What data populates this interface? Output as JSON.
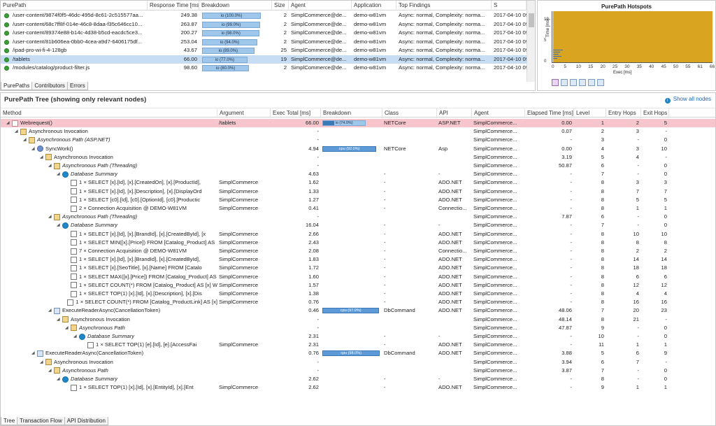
{
  "purepaths": {
    "columns": [
      "PurePath",
      "Response Time [ms]",
      "Breakdown",
      "Size",
      "Agent",
      "Application",
      "Top Findings",
      "S"
    ],
    "rows": [
      {
        "path": "/user-content/9874f0f5-46dc-495d-8c61-2c515577aa...",
        "rt": "249.38",
        "bd": "io (100.0%)",
        "bd_pct": 1.0,
        "size": "2",
        "agent": "SimplCommerce@de...",
        "app": "demo-w81vm",
        "findings": "Async: normal, Complexity: norma...",
        "s": "2017-04-10 09:"
      },
      {
        "path": "/user-content/68c7ff8f-014e-46c8-8daa-f35c646cc10...",
        "rt": "263.87",
        "bd": "io (99.0%)",
        "bd_pct": 0.99,
        "size": "2",
        "agent": "SimplCommerce@de...",
        "app": "demo-w81vm",
        "findings": "Async: normal, Complexity: norma...",
        "s": "2017-04-10 09:"
      },
      {
        "path": "/user-content/89374e88-b14c-4d38-b5cd-eacdc5ce3...",
        "rt": "200.27",
        "bd": "io (98.0%)",
        "bd_pct": 0.98,
        "size": "2",
        "agent": "SimplCommerce@de...",
        "app": "demo-w81vm",
        "findings": "Async: normal, Complexity: norma...",
        "s": "2017-04-10 09:"
      },
      {
        "path": "/user-content/81b606ea-0bb0-4cea-a9d7-6406175df...",
        "rt": "253.04",
        "bd": "io (94.0%)",
        "bd_pct": 0.94,
        "size": "2",
        "agent": "SimplCommerce@de...",
        "app": "demo-w81vm",
        "findings": "Async: normal, Complexity: norma...",
        "s": "2017-04-10 09:"
      },
      {
        "path": "/ipad-pro-wi-fi-4-128gb",
        "rt": "43.67",
        "bd": "io (89.0%)",
        "bd_pct": 0.89,
        "size": "25",
        "agent": "SimplCommerce@de...",
        "app": "demo-w81vm",
        "findings": "Async: normal, Complexity: norma...",
        "s": "2017-04-10 09:"
      },
      {
        "path": "/tablets",
        "rt": "66.00",
        "bd": "io (77.0%)",
        "bd_pct": 0.77,
        "size": "19",
        "agent": "SimplCommerce@de...",
        "app": "demo-w81vm",
        "findings": "Async: normal, Complexity: norma...",
        "s": "2017-04-10 09:"
      },
      {
        "path": "/modules/catalog/product-filter.js",
        "rt": "98.60",
        "bd": "io (80.0%)",
        "bd_pct": 0.8,
        "size": "2",
        "agent": "SimplCommerce@de...",
        "app": "demo-w81vm",
        "findings": "Async: normal, Complexity: norma...",
        "s": "2017-04-10 09:"
      }
    ],
    "tabs": [
      "PurePaths",
      "Contributors",
      "Errors"
    ]
  },
  "hotspots": {
    "title": "PurePath Hotspots",
    "x_label": "Exec [ms]",
    "y_label": "Time [ms]",
    "x_ticks": [
      "0",
      "5",
      "10",
      "15",
      "20",
      "25",
      "30",
      "35",
      "40",
      "45",
      "50",
      "55",
      "61",
      "66"
    ],
    "y_ticks": [
      "19",
      "5",
      "0"
    ]
  },
  "tree": {
    "title": "PurePath Tree (showing only relevant nodes)",
    "show_all": "Show all nodes",
    "columns": [
      "Method",
      "Argument",
      "Exec Total [ms]",
      "Breakdown",
      "Class",
      "API",
      "Agent",
      "Elapsed Time [ms]",
      "Level",
      "Entry Hops",
      "Exit Hops"
    ],
    "rows": [
      {
        "d": 0,
        "icon": "web",
        "method": "Webrequest()",
        "arg": "/tablets",
        "exec": "66.00",
        "bd": "io (74.0%)",
        "bd_pct": 0.74,
        "bd_type": "io",
        "cls": "NETCore",
        "api": "ASP.NET",
        "agent": "SimplCommerce...",
        "el": "0.00",
        "lvl": "1",
        "eh": "2",
        "xh": "5",
        "hl": true
      },
      {
        "d": 1,
        "icon": "async",
        "method": "Asynchronous Invocation",
        "arg": "",
        "exec": "-",
        "bd": "",
        "cls": "",
        "api": "",
        "agent": "SimplCommerce...",
        "el": "0.07",
        "lvl": "2",
        "eh": "3",
        "xh": "-"
      },
      {
        "d": 2,
        "icon": "async",
        "method": "Asynchronous Path (ASP.NET)",
        "it": true,
        "arg": "",
        "exec": "-",
        "bd": "",
        "cls": "",
        "api": "",
        "agent": "SimplCommerce...",
        "el": "-",
        "lvl": "3",
        "eh": "-",
        "xh": "0"
      },
      {
        "d": 3,
        "icon": "sync",
        "method": "SyncWork()",
        "arg": "",
        "exec": "4.94",
        "bd": "cpu (92.0%)",
        "bd_pct": 0.92,
        "bd_type": "cpu",
        "cls": "NETCore",
        "api": "Asp",
        "agent": "SimplCommerce...",
        "el": "0.00",
        "lvl": "4",
        "eh": "3",
        "xh": "10"
      },
      {
        "d": 4,
        "icon": "async",
        "method": "Asynchronous Invocation",
        "arg": "",
        "exec": "-",
        "bd": "",
        "cls": "",
        "api": "",
        "agent": "SimplCommerce...",
        "el": "3.19",
        "lvl": "5",
        "eh": "4",
        "xh": "-"
      },
      {
        "d": 5,
        "icon": "async",
        "method": "Asynchronous Path (Threading)",
        "it": true,
        "arg": "",
        "exec": "-",
        "bd": "",
        "cls": "",
        "api": "",
        "agent": "SimplCommerce...",
        "el": "50.87",
        "lvl": "6",
        "eh": "-",
        "xh": "0"
      },
      {
        "d": 6,
        "icon": "db",
        "method": "Database Summary",
        "it": true,
        "arg": "",
        "exec": "4.63",
        "bd": "",
        "cls": "-",
        "api": "-",
        "agent": "SimplCommerce...",
        "el": "-",
        "lvl": "7",
        "eh": "-",
        "xh": "0"
      },
      {
        "d": 7,
        "icon": "sql",
        "method": "1 × SELECT [x].[Id], [x].[CreatedOn], [x].[ProductId],",
        "arg": "SimplCommerce",
        "exec": "1.62",
        "bd": "",
        "cls": "-",
        "api": "ADO.NET",
        "agent": "SimplCommerce...",
        "el": "-",
        "lvl": "8",
        "eh": "3",
        "xh": "3"
      },
      {
        "d": 7,
        "icon": "sql",
        "method": "1 × SELECT [x].[Id], [x].[Description], [x].[DisplayOrd",
        "arg": "SimplCommerce",
        "exec": "1.33",
        "bd": "",
        "cls": "-",
        "api": "ADO.NET",
        "agent": "SimplCommerce...",
        "el": "-",
        "lvl": "8",
        "eh": "7",
        "xh": "7"
      },
      {
        "d": 7,
        "icon": "sql",
        "method": "1 × SELECT [c0].[Id], [c0].[OptionId], [c0].[Productic",
        "arg": "SimplCommerce",
        "exec": "1.27",
        "bd": "",
        "cls": "-",
        "api": "ADO.NET",
        "agent": "SimplCommerce...",
        "el": "-",
        "lvl": "8",
        "eh": "5",
        "xh": "5"
      },
      {
        "d": 7,
        "icon": "sql",
        "method": "2 × Connection Acquisition @ DEMO-W81VM",
        "arg": "SimplCommerce",
        "exec": "0.41",
        "bd": "",
        "cls": "-",
        "api": "Connectio...",
        "agent": "SimplCommerce...",
        "el": "-",
        "lvl": "8",
        "eh": "1",
        "xh": "1"
      },
      {
        "d": 5,
        "icon": "async",
        "method": "Asynchronous Path (Threading)",
        "it": true,
        "arg": "",
        "exec": "-",
        "bd": "",
        "cls": "",
        "api": "",
        "agent": "SimplCommerce...",
        "el": "7.87",
        "lvl": "6",
        "eh": "-",
        "xh": "0"
      },
      {
        "d": 6,
        "icon": "db",
        "method": "Database Summary",
        "it": true,
        "arg": "",
        "exec": "16.04",
        "bd": "",
        "cls": "-",
        "api": "-",
        "agent": "SimplCommerce...",
        "el": "-",
        "lvl": "7",
        "eh": "-",
        "xh": "0"
      },
      {
        "d": 7,
        "icon": "sql",
        "method": "1 × SELECT [x].[Id], [x].[BrandId], [x].[CreatedById], [x",
        "arg": "SimplCommerce",
        "exec": "2.66",
        "bd": "",
        "cls": "-",
        "api": "ADO.NET",
        "agent": "SimplCommerce...",
        "el": "-",
        "lvl": "8",
        "eh": "10",
        "xh": "10"
      },
      {
        "d": 7,
        "icon": "sql",
        "method": "1 × SELECT MIN([x].[Price]) FROM [Catalog_Product] AS",
        "arg": "SimplCommerce",
        "exec": "2.43",
        "bd": "",
        "cls": "-",
        "api": "ADO.NET",
        "agent": "SimplCommerce...",
        "el": "-",
        "lvl": "8",
        "eh": "8",
        "xh": "8"
      },
      {
        "d": 7,
        "icon": "sql",
        "method": "7 × Connection Acquisition @ DEMO-W81VM",
        "arg": "SimplCommerce",
        "exec": "2.08",
        "bd": "",
        "cls": "-",
        "api": "Connectio...",
        "agent": "SimplCommerce...",
        "el": "-",
        "lvl": "8",
        "eh": "2",
        "xh": "2"
      },
      {
        "d": 7,
        "icon": "sql",
        "method": "1 × SELECT [x].[Id], [x].[BrandId], [x].[CreatedById],",
        "arg": "SimplCommerce",
        "exec": "1.83",
        "bd": "",
        "cls": "-",
        "api": "ADO.NET",
        "agent": "SimplCommerce...",
        "el": "-",
        "lvl": "8",
        "eh": "14",
        "xh": "14"
      },
      {
        "d": 7,
        "icon": "sql",
        "method": "1 × SELECT [x].[SeoTitle], [x].[Name] FROM [Catalo",
        "arg": "SimplCommerce",
        "exec": "1.72",
        "bd": "",
        "cls": "-",
        "api": "ADO.NET",
        "agent": "SimplCommerce...",
        "el": "-",
        "lvl": "8",
        "eh": "18",
        "xh": "18"
      },
      {
        "d": 7,
        "icon": "sql",
        "method": "1 × SELECT MAX([x].[Price]) FROM [Catalog_Product] AS",
        "arg": "SimplCommerce",
        "exec": "1.60",
        "bd": "",
        "cls": "-",
        "api": "ADO.NET",
        "agent": "SimplCommerce...",
        "el": "-",
        "lvl": "8",
        "eh": "6",
        "xh": "6"
      },
      {
        "d": 7,
        "icon": "sql",
        "method": "1 × SELECT COUNT(*) FROM [Catalog_Product] AS [x] W",
        "arg": "SimplCommerce",
        "exec": "1.57",
        "bd": "",
        "cls": "-",
        "api": "ADO.NET",
        "agent": "SimplCommerce...",
        "el": "-",
        "lvl": "8",
        "eh": "12",
        "xh": "12"
      },
      {
        "d": 7,
        "icon": "sql",
        "method": "1 × SELECT TOP(1) [x].[Id], [x].[Description], [x].[Dis",
        "arg": "SimplCommerce",
        "exec": "1.38",
        "bd": "",
        "cls": "-",
        "api": "ADO.NET",
        "agent": "SimplCommerce...",
        "el": "-",
        "lvl": "8",
        "eh": "4",
        "xh": "4"
      },
      {
        "d": 7,
        "icon": "sql",
        "method": "1 × SELECT COUNT(*) FROM [Catalog_ProductLink] AS [x]",
        "arg": "SimplCommerce",
        "exec": "0.76",
        "bd": "",
        "cls": "-",
        "api": "ADO.NET",
        "agent": "SimplCommerce...",
        "el": "-",
        "lvl": "8",
        "eh": "16",
        "xh": "16"
      },
      {
        "d": 5,
        "icon": "mth",
        "method": "ExecuteReaderAsync(CancellationToken)",
        "arg": "",
        "exec": "0.46",
        "bd": "cpu (97.0%)",
        "bd_pct": 0.97,
        "bd_type": "cpu",
        "cls": "DbCommand",
        "api": "ADO.NET",
        "agent": "SimplCommerce...",
        "el": "48.06",
        "lvl": "7",
        "eh": "20",
        "xh": "23"
      },
      {
        "d": 6,
        "icon": "async",
        "method": "Asynchronous Invocation",
        "arg": "",
        "exec": "-",
        "bd": "",
        "cls": "",
        "api": "",
        "agent": "SimplCommerce...",
        "el": "48.14",
        "lvl": "8",
        "eh": "21",
        "xh": "-"
      },
      {
        "d": 7,
        "icon": "async",
        "method": "Asynchronous Path",
        "it": true,
        "arg": "",
        "exec": "-",
        "bd": "",
        "cls": "",
        "api": "",
        "agent": "SimplCommerce...",
        "el": "47.87",
        "lvl": "9",
        "eh": "-",
        "xh": "0"
      },
      {
        "d": 8,
        "icon": "db",
        "method": "Database Summary",
        "it": true,
        "arg": "",
        "exec": "2.31",
        "bd": "",
        "cls": "-",
        "api": "-",
        "agent": "SimplCommerce...",
        "el": "-",
        "lvl": "10",
        "eh": "-",
        "xh": "0"
      },
      {
        "d": 9,
        "icon": "sql",
        "method": "1 × SELECT TOP(1) [e].[Id], [e].[AccessFai",
        "arg": "SimplCommerce",
        "exec": "2.31",
        "bd": "",
        "cls": "-",
        "api": "ADO.NET",
        "agent": "SimplCommerce...",
        "el": "-",
        "lvl": "11",
        "eh": "1",
        "xh": "1"
      },
      {
        "d": 3,
        "icon": "mth",
        "method": "ExecuteReaderAsync(CancellationToken)",
        "arg": "",
        "exec": "0.76",
        "bd": "cpu (98.0%)",
        "bd_pct": 0.98,
        "bd_type": "cpu",
        "cls": "DbCommand",
        "api": "ADO.NET",
        "agent": "SimplCommerce...",
        "el": "3.88",
        "lvl": "5",
        "eh": "6",
        "xh": "9"
      },
      {
        "d": 4,
        "icon": "async",
        "method": "Asynchronous Invocation",
        "arg": "",
        "exec": "-",
        "bd": "",
        "cls": "",
        "api": "",
        "agent": "SimplCommerce...",
        "el": "3.94",
        "lvl": "6",
        "eh": "7",
        "xh": "-"
      },
      {
        "d": 5,
        "icon": "async",
        "method": "Asynchronous Path",
        "it": true,
        "arg": "",
        "exec": "-",
        "bd": "",
        "cls": "",
        "api": "",
        "agent": "SimplCommerce...",
        "el": "3.87",
        "lvl": "7",
        "eh": "-",
        "xh": "0"
      },
      {
        "d": 6,
        "icon": "db",
        "method": "Database Summary",
        "it": true,
        "arg": "",
        "exec": "2.62",
        "bd": "",
        "cls": "-",
        "api": "-",
        "agent": "SimplCommerce...",
        "el": "-",
        "lvl": "8",
        "eh": "-",
        "xh": "0"
      },
      {
        "d": 7,
        "icon": "sql",
        "method": "1 × SELECT TOP(1) [x].[Id], [x].[EntityId], [x].[Ent",
        "arg": "SimplCommerce",
        "exec": "2.62",
        "bd": "",
        "cls": "-",
        "api": "ADO.NET",
        "agent": "SimplCommerce...",
        "el": "-",
        "lvl": "9",
        "eh": "1",
        "xh": "1"
      }
    ],
    "bottom_tabs": [
      "Tree",
      "Transaction Flow",
      "API Distribution"
    ]
  },
  "colors": {
    "highlight": "#f7c6cc",
    "selected": "#c7ddf4",
    "hotspot": "#d9a520",
    "io": "#9fc7ec",
    "cpu": "#5d9ad7"
  }
}
